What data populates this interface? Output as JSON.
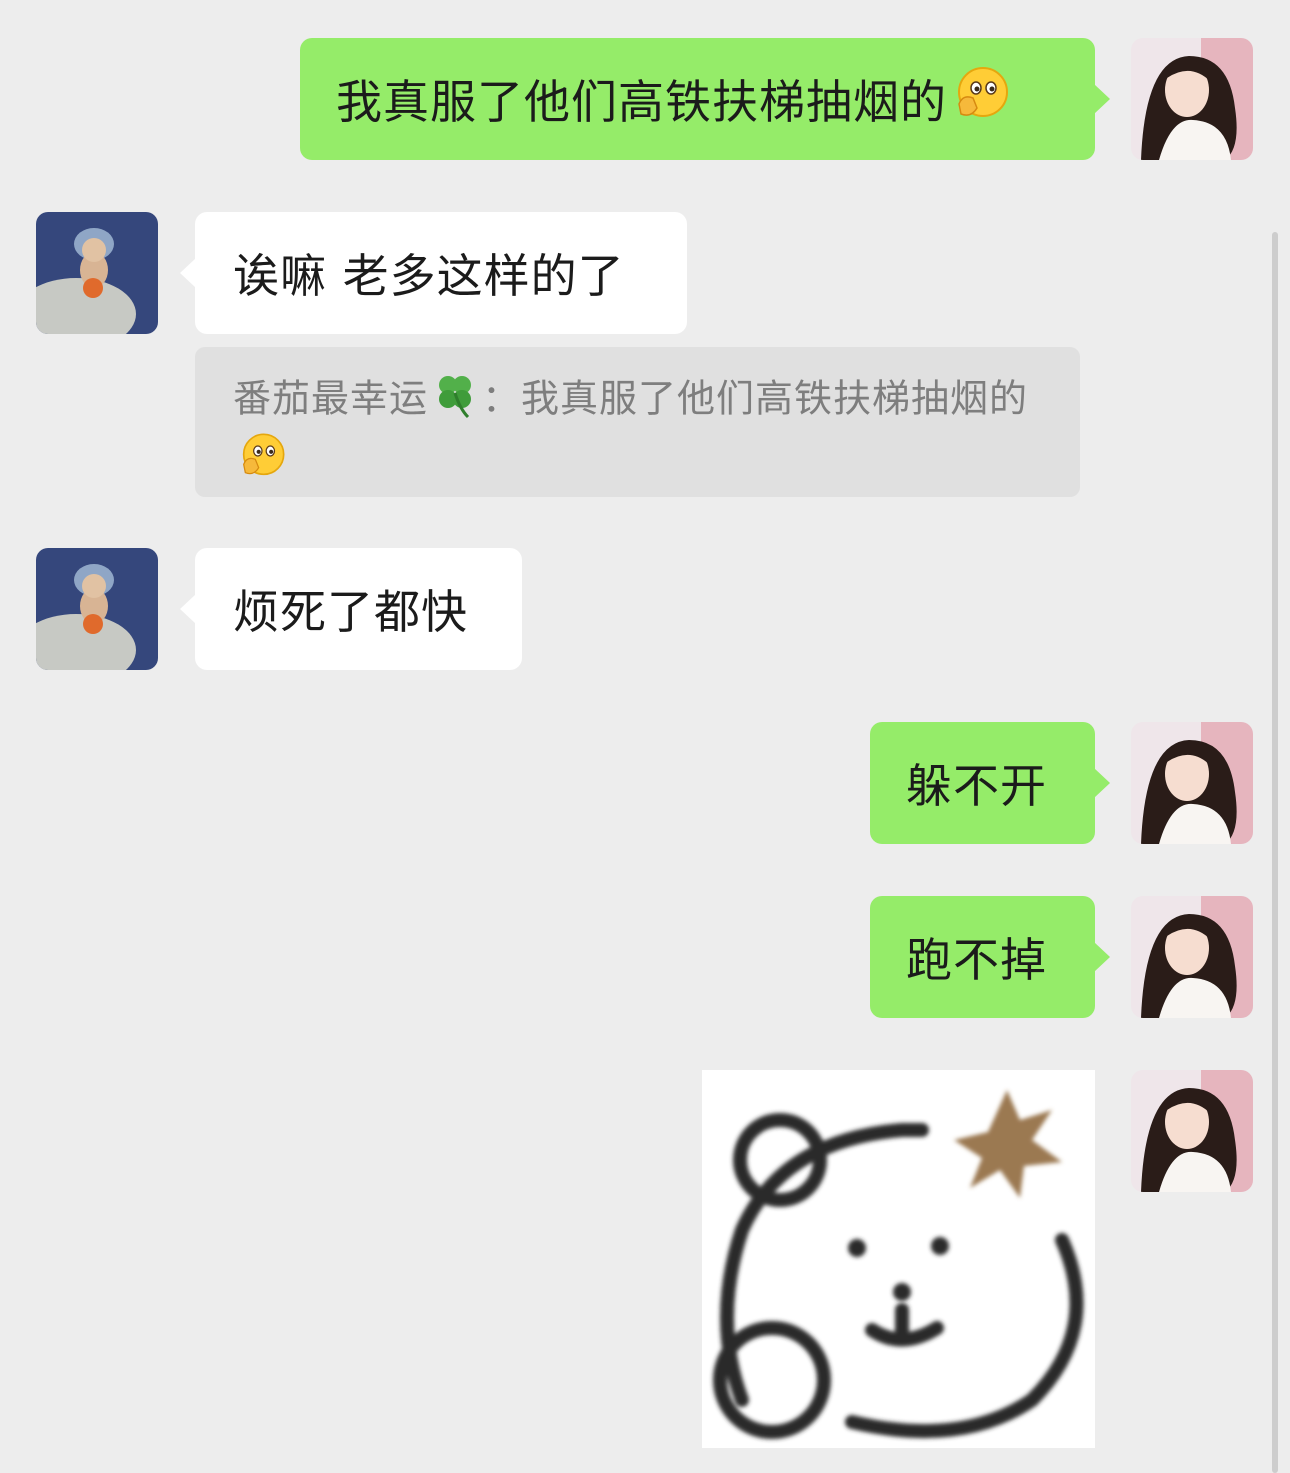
{
  "messages": [
    {
      "sender": "me",
      "text": "我真服了他们高铁扶梯抽烟的",
      "emoji": "hand-over-mouth-emoji"
    },
    {
      "sender": "other",
      "text": "诶嘛 老多这样的了",
      "quote": {
        "name": "番茄最幸运",
        "name_emoji": "four-leaf-clover-emoji",
        "separator": "：",
        "text": "我真服了他们高铁扶梯抽烟的",
        "emoji": "hand-over-mouth-emoji"
      }
    },
    {
      "sender": "other",
      "text": "烦死了都快"
    },
    {
      "sender": "me",
      "text": "躲不开"
    },
    {
      "sender": "me",
      "text": "跑不掉"
    },
    {
      "sender": "me",
      "type": "sticker",
      "sticker": "angry-bear-sticker"
    }
  ],
  "colors": {
    "background": "#ededed",
    "outgoing_bubble": "#95ec69",
    "incoming_bubble": "#ffffff",
    "quote_bubble": "#e0e0e0",
    "quote_text": "#7e7e7e"
  }
}
